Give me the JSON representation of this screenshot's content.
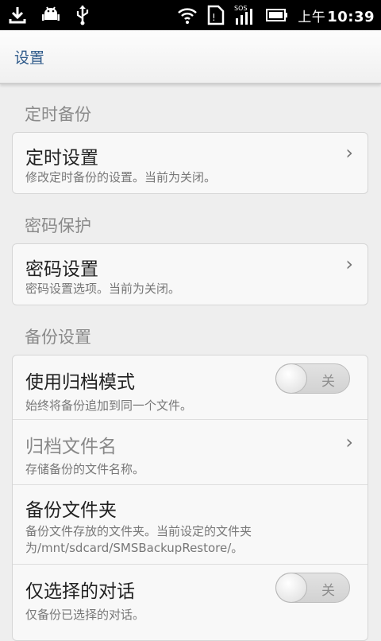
{
  "status_bar": {
    "time_ampm": "上午",
    "time": "10:39",
    "icons": [
      "download-icon",
      "android-debug-icon",
      "usb-icon",
      "wifi-icon",
      "sim-icon",
      "signal-sos-icon",
      "battery-icon"
    ]
  },
  "titlebar": {
    "title": "设置"
  },
  "sections": [
    {
      "header": "定时备份",
      "rows": [
        {
          "title": "定时设置",
          "summary": "修改定时备份的设置。当前为关闭。",
          "chevron": "›"
        }
      ]
    },
    {
      "header": "密码保护",
      "rows": [
        {
          "title": "密码设置",
          "summary": "密码设置选项。当前为关闭。",
          "chevron": "›"
        }
      ]
    },
    {
      "header": "备份设置",
      "rows": [
        {
          "title": "使用归档模式",
          "summary": "始终将备份追加到同一个文件。",
          "toggle": "关"
        },
        {
          "title": "归档文件名",
          "summary": "存储备份的文件名称。",
          "chevron": "›"
        },
        {
          "title": "备份文件夹",
          "summary": "备份文件存放的文件夹。当前设定的文件夹为/mnt/sdcard/SMSBackupRestore/。"
        },
        {
          "title": "仅选择的对话",
          "summary": "仅备份已选择的对话。",
          "toggle": "关"
        }
      ]
    }
  ]
}
